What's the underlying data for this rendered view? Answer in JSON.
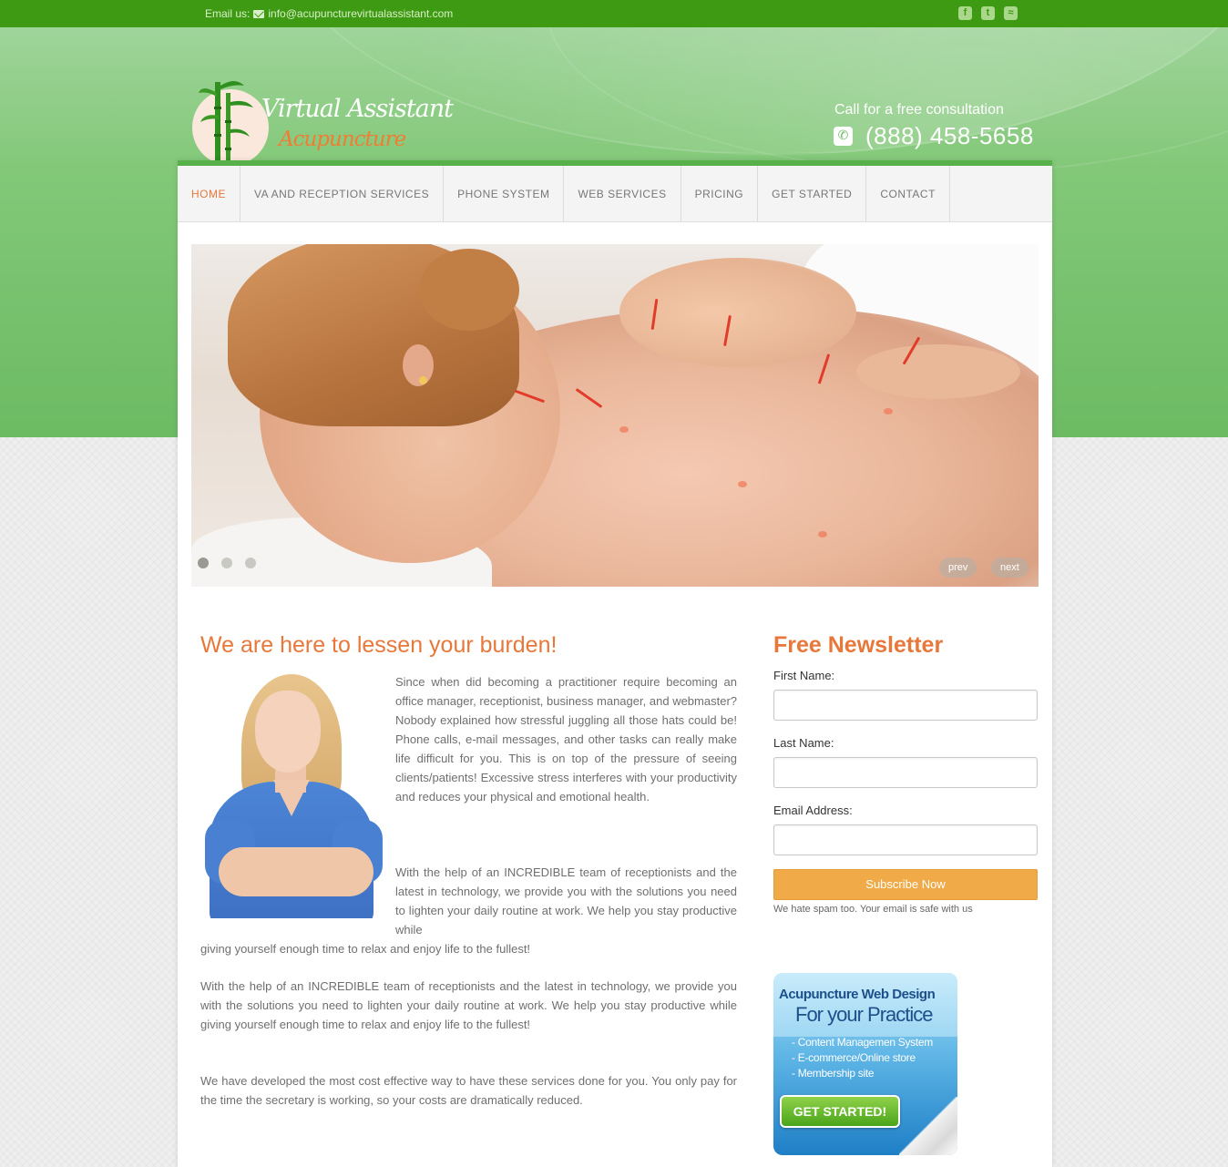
{
  "topbar": {
    "email_label": "Email us:",
    "email": "info@acupuncturevirtualassistant.com",
    "social": [
      "f",
      "t",
      "rss"
    ]
  },
  "header": {
    "logo_line1": "Virtual Assistant",
    "logo_line2": "Acupuncture",
    "call_label": "Call for a free consultation",
    "phone": "(888) 458-5658"
  },
  "nav": {
    "items": [
      "HOME",
      "VA AND RECEPTION SERVICES",
      "PHONE SYSTEM",
      "WEB SERVICES",
      "PRICING",
      "GET STARTED",
      "CONTACT"
    ],
    "active": "HOME"
  },
  "slider": {
    "prev": "prev",
    "next": "next",
    "slide_count": 3,
    "current_slide": 1
  },
  "main": {
    "heading": "We are here to lessen your burden!",
    "para1": "Since when did becoming a practitioner require becoming an office manager, receptionist, business manager, and webmaster? Nobody explained how stressful juggling all those hats could be! Phone calls, e-mail messages, and other tasks can really make life difficult for you. This is on top of the pressure of seeing clients/patients! Excessive stress interferes with your productivity and reduces your physical and emotional health.",
    "para2a": "With the help of an INCREDIBLE team of receptionists and the latest in technology, we provide you with the solutions you need to lighten your daily routine at work. We help you stay productive while",
    "para2b": "giving yourself enough time to relax and enjoy life to the fullest!",
    "para3": "With the help of an INCREDIBLE team of receptionists and the latest in technology, we provide you with the solutions you need to lighten your daily routine at work. We help you stay productive while giving yourself enough time to relax and enjoy life to the fullest!",
    "para4": "We have developed the most cost effective way to have these services done for you. You only pay for the time the secretary is working, so your costs are dramatically reduced."
  },
  "newsletter": {
    "heading": "Free Newsletter",
    "first_name_label": "First Name:",
    "last_name_label": "Last Name:",
    "email_label": "Email Address:",
    "first_name_value": "",
    "last_name_value": "",
    "email_value": "",
    "subscribe": "Subscribe Now",
    "spam_note": "We hate spam too. Your email is safe with us"
  },
  "ad": {
    "title": "Acupuncture Web Design",
    "subtitle": "For your Practice",
    "items": [
      "- Content Managemen System",
      "- E-commerce/Online store",
      "- Membership site"
    ],
    "button": "GET STARTED!"
  },
  "colors": {
    "green_top": "#3f9a13",
    "header_green": "#82c878",
    "accent_orange": "#e8773a",
    "subscribe": "#f0ab48"
  }
}
